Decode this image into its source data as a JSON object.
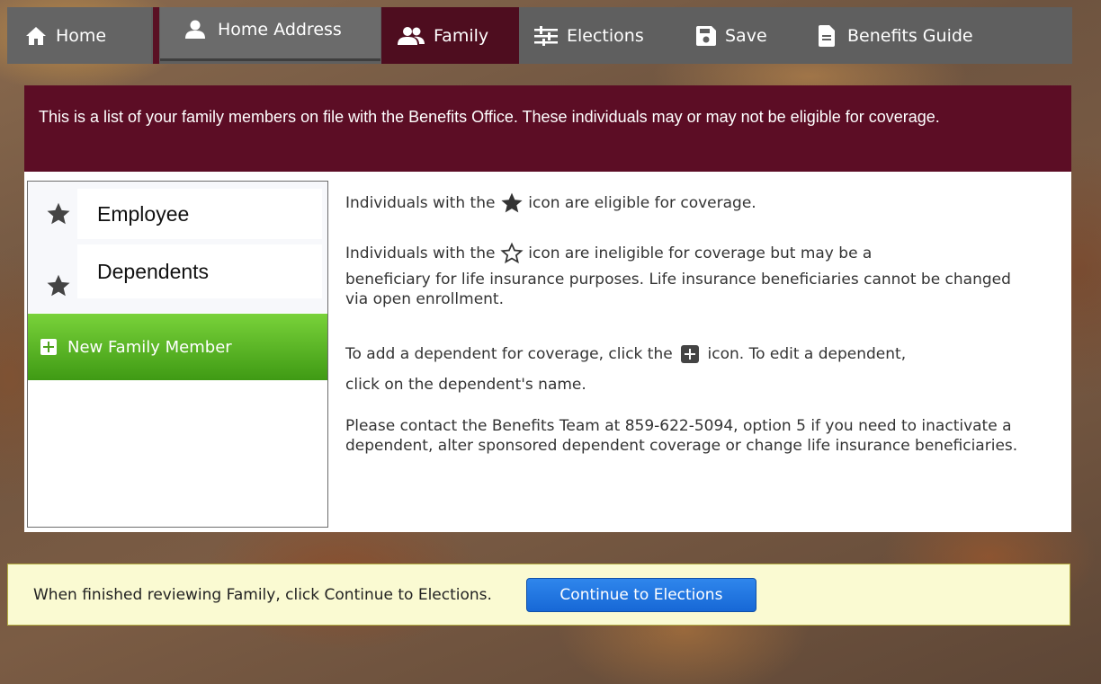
{
  "nav": {
    "home": "Home",
    "home_address": "Home Address",
    "family": "Family",
    "elections": "Elections",
    "save": "Save",
    "benefits_guide": "Benefits Guide"
  },
  "banner": {
    "text": "This is a list of your family members on file with the Benefits Office. These individuals may or may not be eligible for coverage."
  },
  "family_list": {
    "items": [
      {
        "label": "Employee",
        "icon": "filled-star-icon"
      },
      {
        "label": "Dependents",
        "icon": "filled-star-icon"
      }
    ],
    "new_member_label": "New Family Member"
  },
  "info": {
    "eligible_prefix": "Individuals with the",
    "eligible_suffix": "icon are eligible for coverage.",
    "ineligible_prefix": "Individuals with the",
    "ineligible_line1_suffix": "icon are ineligible for coverage but may be a",
    "ineligible_rest": "beneficiary for life insurance purposes. Life insurance beneficiaries cannot be changed via open enrollment.",
    "add_prefix": "To add a dependent for coverage, click the",
    "add_suffix": "icon. To edit a dependent,",
    "add_line2": "click on the dependent's name.",
    "contact": "Please contact the Benefits Team at 859-622-5094, option 5 if you need to inactivate a dependent, alter sponsored dependent coverage or change life insurance beneficiaries."
  },
  "footer": {
    "text": "When finished reviewing Family, click Continue to Elections.",
    "button": "Continue to Elections"
  },
  "colors": {
    "nav_bg": "#5f5f5f",
    "active_tab": "#4e0d1f",
    "banner_bg": "#5c0d25",
    "new_member_green": "#4da21c",
    "continue_blue": "#1f74e0",
    "footer_bg": "#fafad2"
  }
}
